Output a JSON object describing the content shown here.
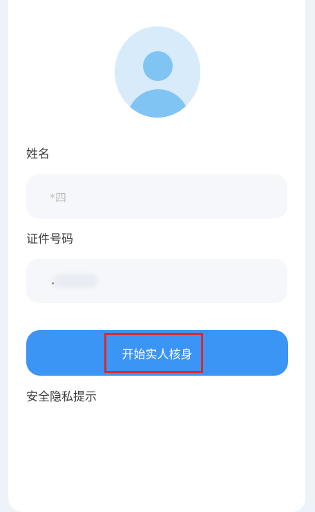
{
  "form": {
    "avatar_icon": "user-avatar-icon",
    "name_label": "姓名",
    "name_value": "*四",
    "id_label": "证件号码",
    "id_value": "",
    "start_button_label": "开始实人核身",
    "privacy_link": "安全隐私提示"
  },
  "colors": {
    "primary": "#3a95f5",
    "avatar_bg": "#d7ebfb",
    "avatar_fg": "#7fc4f3",
    "input_bg": "#f5f7fa",
    "highlight": "#e0262b"
  }
}
